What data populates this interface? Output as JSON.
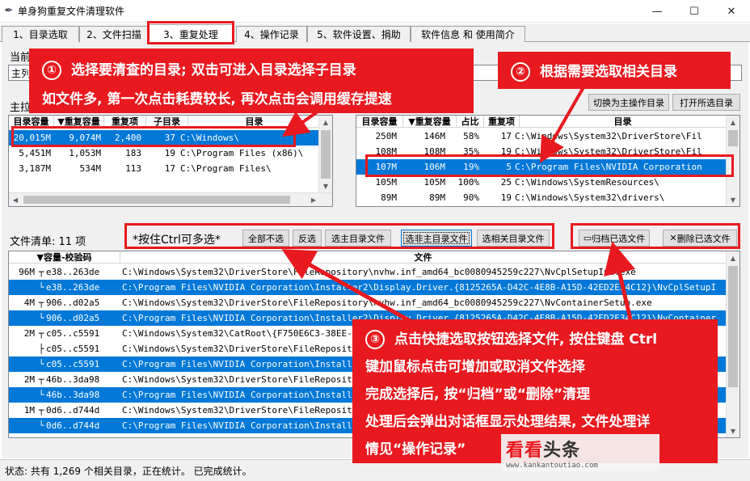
{
  "window": {
    "title": "单身狗重复文件清理软件",
    "minimize": "—",
    "maximize": "☐",
    "close": "✕"
  },
  "tabs": [
    {
      "label": "1、目录选取"
    },
    {
      "label": "2、文件扫描"
    },
    {
      "label": "3、重复处理"
    },
    {
      "label": "4、操作记录"
    },
    {
      "label": "5、软件设置、捐助"
    },
    {
      "label": "软件信息 和 使用简介"
    }
  ],
  "current": {
    "label": "当前",
    "value": "主列"
  },
  "main_dirs": {
    "label": "主拉",
    "headers": [
      "目录容量",
      "▼重复容量",
      "重复项",
      "子目录",
      "目录"
    ],
    "rows": [
      {
        "cap": "20,015M",
        "dup": "9,074M",
        "items": "2,400",
        "sub": "37",
        "dir": "C:\\Windows\\"
      },
      {
        "cap": "5,451M",
        "dup": "1,053M",
        "items": "183",
        "sub": "19",
        "dir": "C:\\Program Files (x86)\\"
      },
      {
        "cap": "3,187M",
        "dup": "534M",
        "items": "113",
        "sub": "17",
        "dir": "C:\\Program Files\\"
      }
    ]
  },
  "related_dirs": {
    "switch_button": "切换为主操作目录",
    "open_button": "打开所选目录",
    "headers": [
      "目录容量",
      "▼重复容量",
      "占比",
      "重复项",
      "目录"
    ],
    "rows": [
      {
        "cap": "250M",
        "dup": "146M",
        "pct": "58%",
        "items": "17",
        "dir": "C:\\Windows\\System32\\DriverStore\\Fil"
      },
      {
        "cap": "108M",
        "dup": "108M",
        "pct": "35%",
        "items": "19",
        "dir": "C:\\Windows\\System32\\DriverStore\\Fil"
      },
      {
        "cap": "107M",
        "dup": "106M",
        "pct": "19%",
        "items": "5",
        "dir": "C:\\Program Files\\NVIDIA Corporation"
      },
      {
        "cap": "105M",
        "dup": "105M",
        "pct": "100%",
        "items": "25",
        "dir": "C:\\Windows\\SystemResources\\"
      },
      {
        "cap": "89M",
        "dup": "89M",
        "pct": "90%",
        "items": "19",
        "dir": "C:\\Windows\\System32\\drivers\\"
      }
    ]
  },
  "files": {
    "label": "文件清单: 11 项",
    "hint": "*按住Ctrl可多选*",
    "buttons": {
      "deselect_all": "全部不选",
      "invert": "反选",
      "select_main": "选主目录文件",
      "select_non_main": "选非主目录文件",
      "select_related": "选相关目录文件",
      "archive": "归档已选文件",
      "delete": "删除已选文件"
    },
    "headers": [
      "▼容量-校验码",
      "文件"
    ],
    "rows": [
      {
        "size": "96M",
        "tree": "┬",
        "hash": "e38..263de",
        "path": "C:\\Windows\\System32\\DriverStore\\FileRepository\\nvhw.inf_amd64_bc0080945259c227\\NvCplSetupInt.exe",
        "selected": false
      },
      {
        "size": "",
        "tree": "└",
        "hash": "e38..263de",
        "path": "C:\\Program Files\\NVIDIA Corporation\\Installer2\\Display.Driver.{8125265A-D42C-4E8B-A15D-42ED2E34C12}\\NvCplSetupIn",
        "selected": true
      },
      {
        "size": "4M",
        "tree": "┬",
        "hash": "906..d02a5",
        "path": "C:\\Windows\\System32\\DriverStore\\FileRepository\\nvhw.inf_amd64_bc0080945259c227\\NvContainerSetup.exe",
        "selected": false
      },
      {
        "size": "",
        "tree": "└",
        "hash": "906..d02a5",
        "path": "C:\\Program Files\\NVIDIA Corporation\\Installer2\\Display.Driver.{8125265A-D42C-4E8B-A15D-42ED2E34C12}\\NvContainer",
        "selected": true
      },
      {
        "size": "2M",
        "tree": "┬",
        "hash": "c05..c5591",
        "path": "C:\\Windows\\System32\\CatRoot\\{F750E6C3-38EE-11D1-85E5-00C04FC295EE}\\nvhw.cat",
        "selected": false
      },
      {
        "size": "",
        "tree": "├",
        "hash": "c05..c5591",
        "path": "C:\\Windows\\System32\\DriverStore\\FileRepository\\nvhw.inf_amd64_bc0080945259c227\\nvhw.cat",
        "selected": false
      },
      {
        "size": "",
        "tree": "└",
        "hash": "c05..c5591",
        "path": "C:\\Program Files\\NVIDIA Corporation\\Installer2\\Display.Driver.{8125265A}\\nvhw.cat",
        "selected": true
      },
      {
        "size": "2M",
        "tree": "┬",
        "hash": "46b..3da98",
        "path": "C:\\Windows\\System32\\DriverStore\\FileRepository\\nvhw.inf_amd64_bc0080945259c227\\nvdisps.dll",
        "selected": false
      },
      {
        "size": "",
        "tree": "└",
        "hash": "46b..3da98",
        "path": "C:\\Program Files\\NVIDIA Corporation\\Installer2\\Display.Driver\\nvdisps.dll",
        "selected": true
      },
      {
        "size": "1M",
        "tree": "┬",
        "hash": "0d6..d744d",
        "path": "C:\\Windows\\System32\\DriverStore\\FileRepository\\nvhw.inf_amd64_bc0080945259c227\\nvtopps.db3",
        "selected": false
      },
      {
        "size": "",
        "tree": "└",
        "hash": "0d6..d744d",
        "path": "C:\\Program Files\\NVIDIA Corporation\\Installer2\\Display.Driver\\nvtopps.db3",
        "selected": true
      }
    ]
  },
  "status": "状态: 共有 1,269 个相关目录，正在统计。 已完成统计。",
  "annotations": {
    "callout1": {
      "num": "①",
      "line1": "选择要清查的目录; 双击可进入目录选择子目录",
      "line2": "如文件多, 第一次点击耗费较长, 再次点击会调用缓存提速"
    },
    "callout2": {
      "num": "②",
      "line1": "根据需要选取相关目录"
    },
    "callout3": {
      "num": "③",
      "line1": "点击快捷选取按钮选择文件, 按住键盘 Ctrl",
      "line2": "键加鼠标点击可增加或取消文件选择",
      "line3": "完成选择后, 按“归档”或“删除”清理",
      "line4": "处理后会弹出对话框显示处理结果, 文件处理详",
      "line5": "情见“操作记录”"
    },
    "accent": "#e8191f"
  },
  "watermark": {
    "brand1": "看看",
    "brand2": "头条",
    "url": "www.kankantoutiao.com"
  }
}
